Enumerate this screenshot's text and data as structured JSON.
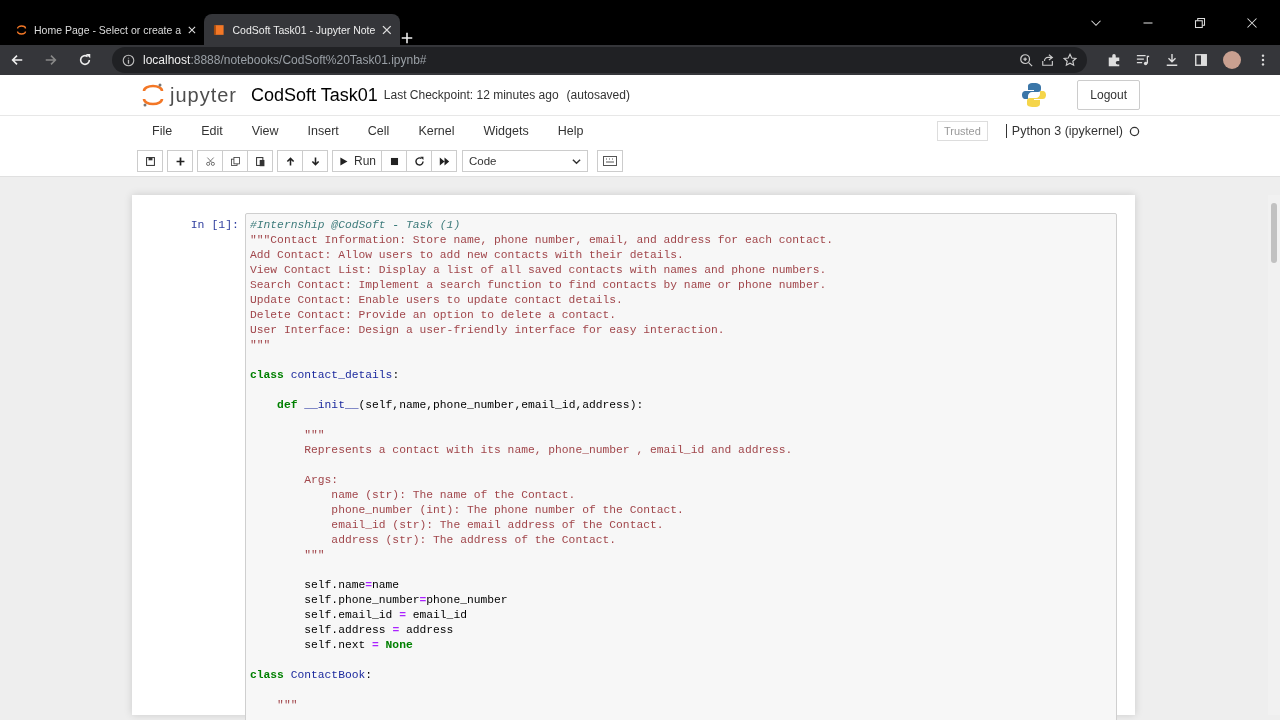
{
  "browser": {
    "tabs": [
      {
        "title": "Home Page - Select or create a",
        "kind": "jupyter",
        "selected": false
      },
      {
        "title": "CodSoft Task01 - Jupyter Note",
        "kind": "notebook",
        "selected": true
      }
    ],
    "url": {
      "host": "localhost",
      "path": ":8888/notebooks/CodSoft%20Task01.ipynb#"
    }
  },
  "header": {
    "logo_text": "jupyter",
    "notebook_name": "CodSoft Task01",
    "checkpoint": "Last Checkpoint: 12 minutes ago",
    "autosave": "(autosaved)",
    "logout": "Logout"
  },
  "menu": [
    "File",
    "Edit",
    "View",
    "Insert",
    "Cell",
    "Kernel",
    "Widgets",
    "Help"
  ],
  "trusted": "Trusted",
  "kernel": {
    "name": "Python 3 (ipykernel)",
    "busy": false
  },
  "toolbar": [
    {
      "buttons": [
        {
          "kind": "save"
        }
      ]
    },
    {
      "buttons": [
        {
          "kind": "add"
        }
      ]
    },
    {
      "buttons": [
        {
          "kind": "cut"
        },
        {
          "kind": "copy"
        },
        {
          "kind": "paste"
        }
      ]
    },
    {
      "buttons": [
        {
          "kind": "up"
        },
        {
          "kind": "down"
        }
      ]
    },
    {
      "buttons": [
        {
          "kind": "run",
          "label": "Run"
        },
        {
          "kind": "stop"
        },
        {
          "kind": "restart"
        },
        {
          "kind": "fast-forward"
        }
      ]
    }
  ],
  "cell_type": "Code",
  "cell": {
    "prompt": "In [1]:",
    "blocks": [
      {
        "lines": [
          {
            "tokens": [
              {
                "t": "#Internship @CodSoft - Task (1)",
                "kind": "comment"
              }
            ]
          },
          {
            "tokens": [
              {
                "t": "\"\"\"Contact Information: Store name, phone number, email, and address for each contact.",
                "kind": "string"
              }
            ]
          },
          {
            "tokens": [
              {
                "t": "Add Contact: Allow users to add new contacts with their details.",
                "kind": "string"
              }
            ]
          },
          {
            "tokens": [
              {
                "t": "View Contact List: Display a list of all saved contacts with names and phone numbers.",
                "kind": "string"
              }
            ]
          },
          {
            "tokens": [
              {
                "t": "Search Contact: Implement a search function to find contacts by name or phone number.",
                "kind": "string"
              }
            ]
          },
          {
            "tokens": [
              {
                "t": "Update Contact: Enable users to update contact details.",
                "kind": "string"
              }
            ]
          },
          {
            "tokens": [
              {
                "t": "Delete Contact: Provide an option to delete a contact.",
                "kind": "string"
              }
            ]
          },
          {
            "tokens": [
              {
                "t": "User Interface: Design a user-friendly interface for easy interaction.",
                "kind": "string"
              }
            ]
          },
          {
            "tokens": [
              {
                "t": "\"\"\"",
                "kind": "string"
              }
            ]
          }
        ]
      },
      {
        "lines": [
          {
            "tokens": [
              {
                "t": "class ",
                "kind": "keyword"
              },
              {
                "t": "contact_details",
                "kind": "name"
              },
              {
                "t": ":",
                "kind": "plain"
              }
            ]
          }
        ]
      },
      {
        "lines": [
          {
            "tokens": [
              {
                "t": "    def ",
                "kind": "keyword"
              },
              {
                "t": "__init__",
                "kind": "name"
              },
              {
                "t": "(self,name,phone_number,email_id,address):",
                "kind": "plain"
              }
            ]
          }
        ]
      },
      {
        "lines": [
          {
            "tokens": [
              {
                "t": "        \"\"\"",
                "kind": "string"
              }
            ]
          },
          {
            "tokens": [
              {
                "t": "        Represents a contact with its name, phone_number , email_id and address.",
                "kind": "string"
              }
            ]
          }
        ]
      },
      {
        "lines": [
          {
            "tokens": [
              {
                "t": "        Args:",
                "kind": "string"
              }
            ]
          },
          {
            "tokens": [
              {
                "t": "            name (str): The name of the Contact.",
                "kind": "string"
              }
            ]
          },
          {
            "tokens": [
              {
                "t": "            phone_number (int): The phone number of the Contact.",
                "kind": "string"
              }
            ]
          },
          {
            "tokens": [
              {
                "t": "            email_id (str): The email address of the Contact.",
                "kind": "string"
              }
            ]
          },
          {
            "tokens": [
              {
                "t": "            address (str): The address of the Contact.",
                "kind": "string"
              }
            ]
          },
          {
            "tokens": [
              {
                "t": "        \"\"\"",
                "kind": "string"
              }
            ]
          }
        ]
      },
      {
        "lines": [
          {
            "tokens": [
              {
                "t": "        self.name",
                "kind": "plain"
              },
              {
                "t": "=",
                "kind": "operator"
              },
              {
                "t": "name",
                "kind": "plain"
              }
            ]
          },
          {
            "tokens": [
              {
                "t": "        self.phone_number",
                "kind": "plain"
              },
              {
                "t": "=",
                "kind": "operator"
              },
              {
                "t": "phone_number",
                "kind": "plain"
              }
            ]
          },
          {
            "tokens": [
              {
                "t": "        self.email_id ",
                "kind": "plain"
              },
              {
                "t": "=",
                "kind": "operator"
              },
              {
                "t": " email_id",
                "kind": "plain"
              }
            ]
          },
          {
            "tokens": [
              {
                "t": "        self.address ",
                "kind": "plain"
              },
              {
                "t": "=",
                "kind": "operator"
              },
              {
                "t": " address",
                "kind": "plain"
              }
            ]
          },
          {
            "tokens": [
              {
                "t": "        self.next ",
                "kind": "plain"
              },
              {
                "t": "=",
                "kind": "operator"
              },
              {
                "t": " None",
                "kind": "keyword"
              }
            ]
          }
        ]
      },
      {
        "lines": [
          {
            "tokens": [
              {
                "t": "class ",
                "kind": "keyword"
              },
              {
                "t": "ContactBook",
                "kind": "name"
              },
              {
                "t": ":",
                "kind": "plain"
              }
            ]
          }
        ]
      },
      {
        "lines": [
          {
            "tokens": [
              {
                "t": "    \"\"\"",
                "kind": "string"
              }
            ]
          }
        ]
      }
    ]
  }
}
